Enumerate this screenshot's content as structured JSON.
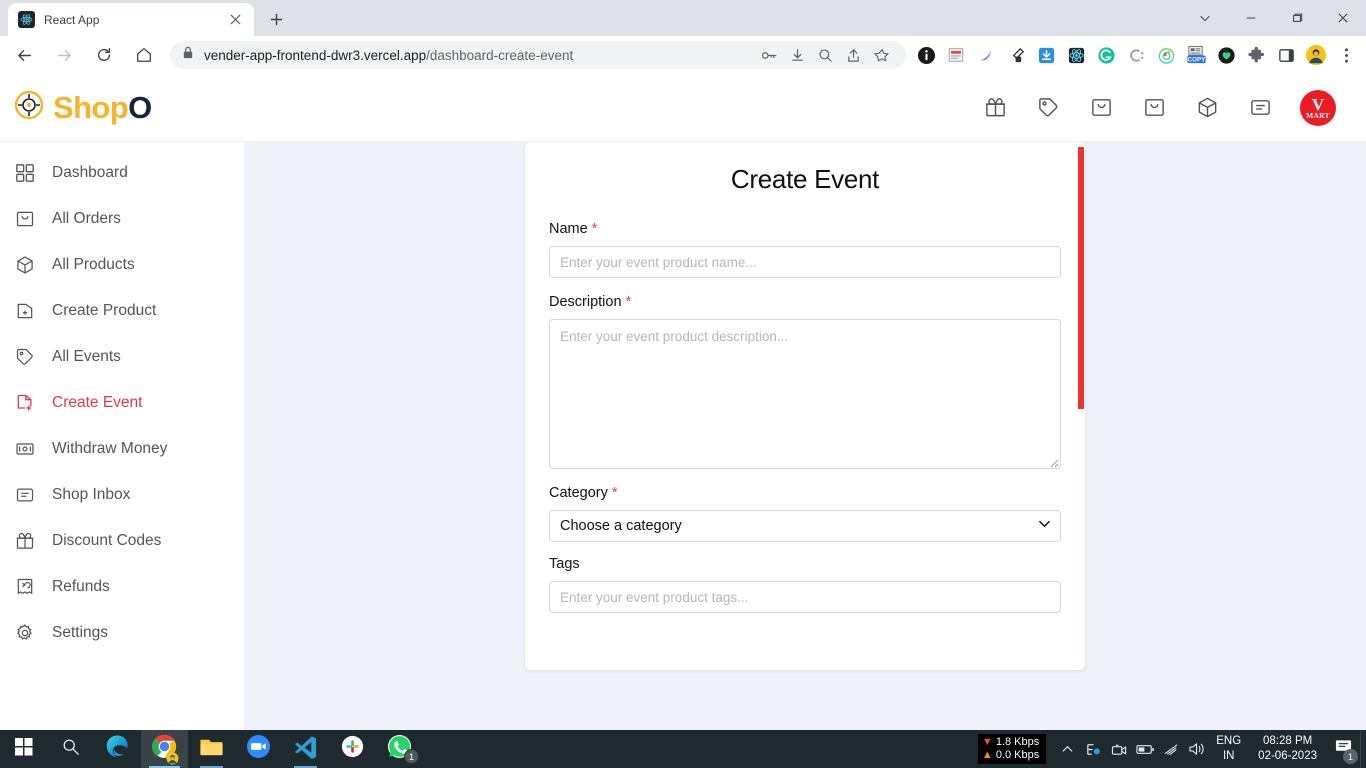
{
  "browser": {
    "tab": {
      "title": "React App",
      "favicon": "react-icon",
      "close": "×"
    },
    "newtab_label": "+",
    "window_controls": [
      "tab-search-chevron",
      "minimize",
      "maximize",
      "close"
    ],
    "nav": {
      "back": "back-arrow",
      "forward": "forward-arrow",
      "reload": "reload-icon",
      "home": "home-icon"
    },
    "omnibox": {
      "lock": "lock-icon",
      "url_host": "vender-app-frontend-dwr3.vercel.app",
      "url_path": "/dashboard-create-event",
      "right_icons": [
        "key-icon",
        "download-icon",
        "zoom-icon",
        "share-icon",
        "bookmark-star-icon"
      ]
    },
    "extensions": [
      "info-badge-icon",
      "notes-icon",
      "gradient-icon",
      "eyedropper-icon",
      "download-blue-icon",
      "react-devtools-icon",
      "grammarly-icon",
      "c-colon-icon",
      "target-icon",
      "copy-icon",
      "heart-shield-icon",
      "puzzle-extensions-icon",
      "sidepanel-icon",
      "profile-avatar-icon",
      "chrome-menu-icon"
    ]
  },
  "site": {
    "logo": {
      "shop": "Shop",
      "o": "O",
      "mark": "target-logo-icon"
    },
    "header_icons": [
      "gift-icon",
      "tag-icon",
      "shopping-bag-icon",
      "shopping-bag-2-icon",
      "package-icon",
      "message-icon"
    ],
    "avatar": {
      "v": "V",
      "mart": "MART"
    }
  },
  "sidebar": {
    "items": [
      {
        "label": "Dashboard",
        "icon": "grid-dashboard-icon",
        "active": false
      },
      {
        "label": "All Orders",
        "icon": "shopping-bag-icon",
        "active": false
      },
      {
        "label": "All Products",
        "icon": "package-icon",
        "active": false
      },
      {
        "label": "Create Product",
        "icon": "file-plus-icon",
        "active": false
      },
      {
        "label": "All Events",
        "icon": "tag-icon",
        "active": false
      },
      {
        "label": "Create Event",
        "icon": "file-add-icon",
        "active": true
      },
      {
        "label": "Withdraw Money",
        "icon": "money-icon",
        "active": false
      },
      {
        "label": "Shop Inbox",
        "icon": "inbox-message-icon",
        "active": false
      },
      {
        "label": "Discount Codes",
        "icon": "gift-icon",
        "active": false
      },
      {
        "label": "Refunds",
        "icon": "refund-arrow-icon",
        "active": false
      },
      {
        "label": "Settings",
        "icon": "gear-icon",
        "active": false
      }
    ]
  },
  "form": {
    "title": "Create Event",
    "name": {
      "label": "Name",
      "required": "*",
      "placeholder": "Enter your event product name...",
      "value": ""
    },
    "description": {
      "label": "Description",
      "required": "*",
      "placeholder": "Enter your event product description...",
      "value": ""
    },
    "category": {
      "label": "Category",
      "required": "*",
      "selected": "Choose a category",
      "options": [
        "Choose a category"
      ]
    },
    "tags": {
      "label": "Tags",
      "placeholder": "Enter your event product tags...",
      "value": ""
    }
  },
  "taskbar": {
    "items": [
      {
        "name": "start-button",
        "icon": "windows-logo-icon"
      },
      {
        "name": "search-button",
        "icon": "search-icon"
      },
      {
        "name": "edge-button",
        "icon": "edge-icon"
      },
      {
        "name": "chrome-button",
        "icon": "chrome-icon"
      },
      {
        "name": "file-explorer-button",
        "icon": "folder-icon"
      },
      {
        "name": "zoom-button",
        "icon": "zoom-app-icon"
      },
      {
        "name": "vscode-button",
        "icon": "vscode-icon"
      },
      {
        "name": "slack-button",
        "icon": "slack-icon"
      },
      {
        "name": "whatsapp-button",
        "icon": "whatsapp-icon",
        "badge": "1"
      }
    ],
    "network": {
      "down": "1.8 Kbps",
      "up": "0.0 Kbps",
      "down_arrow": "▼",
      "up_arrow": "▲"
    },
    "tray_icons": [
      "chevron-up-icon",
      "network-share-icon",
      "camera-icon",
      "battery-icon",
      "wifi-icon",
      "volume-icon"
    ],
    "language": {
      "line1": "ENG",
      "line2": "IN"
    },
    "clock": {
      "time": "08:28 PM",
      "date": "02-06-2023"
    },
    "notifications": {
      "icon": "notification-icon",
      "count": "1"
    }
  },
  "colors": {
    "accent_red": "#e03a52",
    "logo_amber": "#f7b32b",
    "logo_navy": "#16253d",
    "page_bg": "#eef1f8",
    "scrollbar": "#e33333"
  }
}
